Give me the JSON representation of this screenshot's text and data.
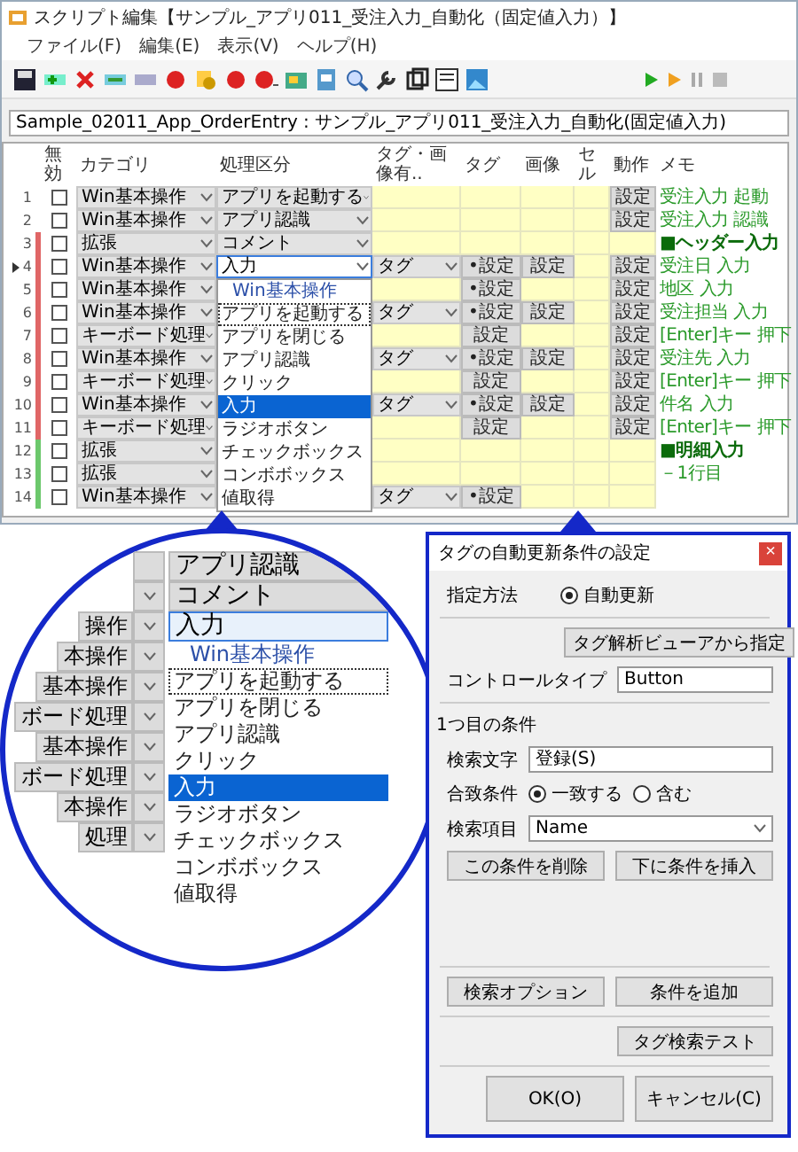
{
  "window": {
    "title": "スクリプト編集【サンプル_アプリ011_受注入力_自動化（固定値入力）】"
  },
  "menu": [
    "ファイル(F)",
    "編集(E)",
    "表示(V)",
    "ヘルプ(H)"
  ],
  "script_path": "Sample_02011_App_OrderEntry : サンプル_アプリ011_受注入力_自動化(固定値入力)",
  "table": {
    "columns": [
      "無効",
      "カテゴリ",
      "処理区分",
      "タグ・画像有..",
      "タグ",
      "画像",
      "セル",
      "動作",
      "メモ"
    ],
    "rows": [
      {
        "number": "1",
        "current": false,
        "disabled": false,
        "category": "Win基本操作",
        "process": "アプリを起動する",
        "editing": false,
        "action": "設定",
        "memo": "受注入力 起動",
        "memo_heading": false
      },
      {
        "number": "2",
        "current": false,
        "disabled": false,
        "category": "Win基本操作",
        "process": "アプリ認識",
        "editing": false,
        "action": "設定",
        "memo": "受注入力 認識",
        "memo_heading": false
      },
      {
        "number": "3",
        "current": false,
        "disabled": false,
        "color": "#e06666",
        "category": "拡張",
        "process": "コメント",
        "editing": false,
        "memo": "■ヘッダー入力",
        "memo_heading": true
      },
      {
        "number": "4",
        "current": true,
        "disabled": false,
        "color": "#e06666",
        "category": "Win基本操作",
        "process": "入力",
        "editing": true,
        "tag_combo": "タグ",
        "tag": "•設定",
        "image": "設定",
        "action": "設定",
        "memo": "受注日 入力",
        "memo_heading": false
      },
      {
        "number": "5",
        "current": false,
        "disabled": false,
        "color": "#e06666",
        "category": "Win基本操作",
        "tag": "•設定",
        "action": "設定",
        "memo": "地区 入力",
        "memo_heading": false
      },
      {
        "number": "6",
        "current": false,
        "disabled": false,
        "color": "#e06666",
        "category": "Win基本操作",
        "tag_combo": "タグ",
        "tag": "•設定",
        "image": "設定",
        "action": "設定",
        "memo": "受注担当 入力",
        "memo_heading": false
      },
      {
        "number": "7",
        "current": false,
        "disabled": false,
        "color": "#e06666",
        "category": "キーボード処理",
        "tag": "設定",
        "action": "設定",
        "memo": "[Enter]キー 押下",
        "memo_heading": false
      },
      {
        "number": "8",
        "current": false,
        "disabled": false,
        "color": "#e06666",
        "category": "Win基本操作",
        "tag_combo": "タグ",
        "tag": "•設定",
        "image": "設定",
        "action": "設定",
        "memo": "受注先 入力",
        "memo_heading": false
      },
      {
        "number": "9",
        "current": false,
        "disabled": false,
        "color": "#e06666",
        "category": "キーボード処理",
        "tag": "設定",
        "action": "設定",
        "memo": "[Enter]キー 押下",
        "memo_heading": false
      },
      {
        "number": "10",
        "current": false,
        "disabled": false,
        "color": "#e06666",
        "category": "Win基本操作",
        "tag_combo": "タグ",
        "tag": "•設定",
        "image": "設定",
        "action": "設定",
        "memo": "件名 入力",
        "memo_heading": false
      },
      {
        "number": "11",
        "current": false,
        "disabled": false,
        "color": "#e06666",
        "category": "キーボード処理",
        "tag": "設定",
        "action": "設定",
        "memo": "[Enter]キー 押下",
        "memo_heading": false
      },
      {
        "number": "12",
        "current": false,
        "disabled": false,
        "color": "#6cc86c",
        "category": "拡張",
        "memo": "■明細入力",
        "memo_heading": true
      },
      {
        "number": "13",
        "current": false,
        "disabled": false,
        "color": "#6cc86c",
        "category": "拡張",
        "memo": "－1行目",
        "memo_heading": false
      },
      {
        "number": "14",
        "current": false,
        "disabled": false,
        "color": "#6cc86c",
        "category": "Win基本操作",
        "tag_combo": "タグ",
        "tag": "•設定"
      }
    ]
  },
  "dropdown": {
    "items": [
      {
        "kind": "group",
        "label": "Win基本操作",
        "selected": false,
        "focused": false
      },
      {
        "kind": "option",
        "label": "アプリを起動する",
        "selected": false,
        "focused": true
      },
      {
        "kind": "option",
        "label": "アプリを閉じる",
        "selected": false,
        "focused": false
      },
      {
        "kind": "option",
        "label": "アプリ認識",
        "selected": false,
        "focused": false
      },
      {
        "kind": "option",
        "label": "クリック",
        "selected": false,
        "focused": false
      },
      {
        "kind": "option",
        "label": "入力",
        "selected": true,
        "focused": false
      },
      {
        "kind": "option",
        "label": "ラジオボタン",
        "selected": false,
        "focused": false
      },
      {
        "kind": "option",
        "label": "チェックボックス",
        "selected": false,
        "focused": false
      },
      {
        "kind": "option",
        "label": "コンボボックス",
        "selected": false,
        "focused": false
      },
      {
        "kind": "option",
        "label": "値取得",
        "selected": false,
        "focused": false
      }
    ]
  },
  "magnifier": {
    "top_cells": [
      "アプリ認識",
      "コメント"
    ],
    "edit_row": {
      "category": "操作",
      "process": "入力"
    },
    "categories": [
      "本操作",
      "基本操作",
      "ボード処理",
      "基本操作",
      "ボード処理",
      "本操作",
      "処理"
    ],
    "items": [
      {
        "kind": "group",
        "label": "Win基本操作",
        "selected": false,
        "focused": false
      },
      {
        "kind": "option",
        "label": "アプリを起動する",
        "selected": false,
        "focused": true
      },
      {
        "kind": "option",
        "label": "アプリを閉じる",
        "selected": false,
        "focused": false
      },
      {
        "kind": "option",
        "label": "アプリ認識",
        "selected": false,
        "focused": false
      },
      {
        "kind": "option",
        "label": "クリック",
        "selected": false,
        "focused": false
      },
      {
        "kind": "option",
        "label": "入力",
        "selected": true,
        "focused": false
      },
      {
        "kind": "option",
        "label": "ラジオボタン",
        "selected": false,
        "focused": false
      },
      {
        "kind": "option",
        "label": "チェックボックス",
        "selected": false,
        "focused": false
      },
      {
        "kind": "option",
        "label": "コンボボックス",
        "selected": false,
        "focused": false
      },
      {
        "kind": "option",
        "label": "値取得",
        "selected": false,
        "focused": false
      }
    ]
  },
  "dialog": {
    "title": "タグの自動更新条件の設定",
    "close": "×",
    "method_label": "指定方法",
    "method_options": [
      {
        "label": "自動更新",
        "selected": true
      }
    ],
    "viewer_button": "タグ解析ビューアから指定",
    "control_type_label": "コントロールタイプ",
    "control_type": "Button",
    "condition_heading": "1つ目の条件",
    "search_text_label": "検索文字",
    "search_text": "登録(S)",
    "match_label": "合致条件",
    "match_options": [
      {
        "label": "一致する",
        "selected": true
      },
      {
        "label": "含む",
        "selected": false
      }
    ],
    "search_item_label": "検索項目",
    "search_item": "Name",
    "condition_buttons": [
      "この条件を削除",
      "下に条件を挿入"
    ],
    "option_buttons": [
      "検索オプション",
      "条件を追加"
    ],
    "test_button": "タグ検索テスト",
    "footer_buttons": [
      "OK(O)",
      "キャンセル(C)"
    ]
  }
}
